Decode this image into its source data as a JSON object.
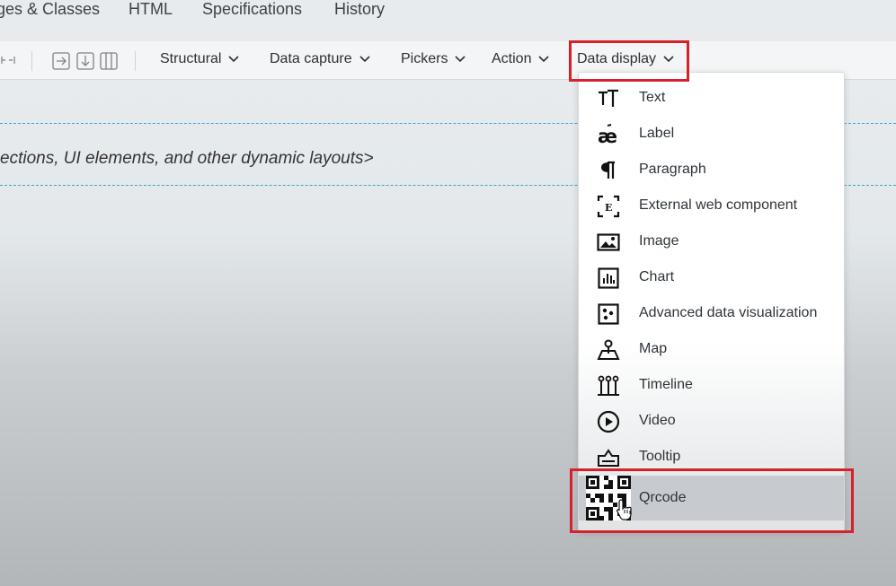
{
  "tabs": [
    "ges & Classes",
    "HTML",
    "Specifications",
    "History"
  ],
  "toolbar": {
    "menus": [
      "Structural",
      "Data capture",
      "Pickers",
      "Action",
      "Data display"
    ]
  },
  "canvas": {
    "placeholder": "ections, UI elements, and other dynamic layouts>"
  },
  "dropdown": {
    "items": [
      {
        "label": "Text",
        "icon": "text-icon"
      },
      {
        "label": "Label",
        "icon": "label-icon"
      },
      {
        "label": "Paragraph",
        "icon": "paragraph-icon"
      },
      {
        "label": "External web component",
        "icon": "external-component-icon"
      },
      {
        "label": "Image",
        "icon": "image-icon"
      },
      {
        "label": "Chart",
        "icon": "chart-icon"
      },
      {
        "label": "Advanced data visualization",
        "icon": "data-visualization-icon"
      },
      {
        "label": "Map",
        "icon": "map-icon"
      },
      {
        "label": "Timeline",
        "icon": "timeline-icon"
      },
      {
        "label": "Video",
        "icon": "video-icon"
      },
      {
        "label": "Tooltip",
        "icon": "tooltip-icon"
      },
      {
        "label": "Qrcode",
        "icon": "qrcode-icon"
      }
    ]
  },
  "colors": {
    "highlight": "#d6212b",
    "selected_row": "#c7cbcf",
    "dashed_line": "#38a3d6"
  }
}
